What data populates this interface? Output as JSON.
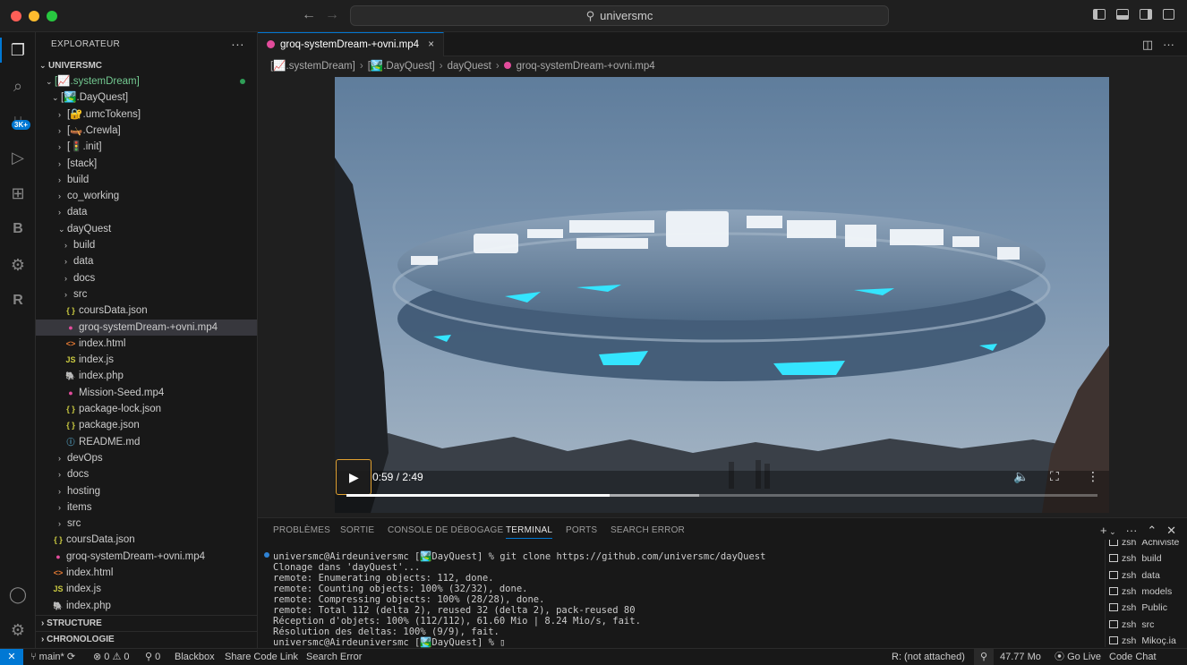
{
  "window": {
    "search_text": "universmc"
  },
  "explorer": {
    "title": "EXPLORATEUR",
    "root": "UNIVERSMC",
    "rows": [
      {
        "label": "[📈.systemDream]",
        "indent": 1,
        "type": "open",
        "green": true
      },
      {
        "label": "[🏞️.DayQuest]",
        "indent": 2,
        "type": "open"
      },
      {
        "label": "[🔐.umcTokens]",
        "indent": 3,
        "type": "closed"
      },
      {
        "label": "[🛶.Crewla]",
        "indent": 3,
        "type": "closed"
      },
      {
        "label": "[🚦.init]",
        "indent": 3,
        "type": "closed"
      },
      {
        "label": "[stack]",
        "indent": 3,
        "type": "closed"
      },
      {
        "label": "build",
        "indent": 3,
        "type": "closed"
      },
      {
        "label": "co_working",
        "indent": 3,
        "type": "closed"
      },
      {
        "label": "data",
        "indent": 3,
        "type": "closed"
      },
      {
        "label": "dayQuest",
        "indent": 3,
        "type": "open"
      },
      {
        "label": "build",
        "indent": 4,
        "type": "closed"
      },
      {
        "label": "data",
        "indent": 4,
        "type": "closed"
      },
      {
        "label": "docs",
        "indent": 4,
        "type": "closed"
      },
      {
        "label": "src",
        "indent": 4,
        "type": "closed"
      },
      {
        "label": "coursData.json",
        "indent": 4,
        "type": "json"
      },
      {
        "label": "groq-systemDream-+ovni.mp4",
        "indent": 4,
        "type": "mp4",
        "selected": true
      },
      {
        "label": "index.html",
        "indent": 4,
        "type": "html"
      },
      {
        "label": "index.js",
        "indent": 4,
        "type": "js"
      },
      {
        "label": "index.php",
        "indent": 4,
        "type": "php"
      },
      {
        "label": "Mission-Seed.mp4",
        "indent": 4,
        "type": "mp4"
      },
      {
        "label": "package-lock.json",
        "indent": 4,
        "type": "json"
      },
      {
        "label": "package.json",
        "indent": 4,
        "type": "json"
      },
      {
        "label": "README.md",
        "indent": 4,
        "type": "md"
      },
      {
        "label": "devOps",
        "indent": 3,
        "type": "closed"
      },
      {
        "label": "docs",
        "indent": 3,
        "type": "closed"
      },
      {
        "label": "hosting",
        "indent": 3,
        "type": "closed"
      },
      {
        "label": "items",
        "indent": 3,
        "type": "closed"
      },
      {
        "label": "src",
        "indent": 3,
        "type": "closed"
      },
      {
        "label": "coursData.json",
        "indent": 2,
        "type": "json"
      },
      {
        "label": "groq-systemDream-+ovni.mp4",
        "indent": 2,
        "type": "mp4"
      },
      {
        "label": "index.html",
        "indent": 2,
        "type": "html"
      },
      {
        "label": "index.js",
        "indent": 2,
        "type": "js"
      },
      {
        "label": "index.php",
        "indent": 2,
        "type": "php"
      }
    ],
    "structure_label": "STRUCTURE",
    "timeline_label": "CHRONOLOGIE"
  },
  "activity": {
    "badge": "3K+"
  },
  "editor": {
    "tab_label": "groq-systemDream-+ovni.mp4",
    "breadcrumb": [
      "[📈.systemDream]",
      "[🏞️.DayQuest]",
      "dayQuest",
      "groq-systemDream-+ovni.mp4"
    ],
    "video": {
      "time": "0:59 / 2:49",
      "progress_fraction": 0.35,
      "buffered_fraction": 0.47
    }
  },
  "panel": {
    "tabs": [
      "PROBLÈMES",
      "SORTIE",
      "CONSOLE DE DÉBOGAGE",
      "TERMINAL",
      "PORTS",
      "SEARCH ERROR"
    ],
    "terminal_lines": [
      "universmc@Airdeuniversmc [🏞️DayQuest] % git clone https://github.com/universmc/dayQuest",
      "Clonage dans 'dayQuest'...",
      "remote: Enumerating objects: 112, done.",
      "remote: Counting objects: 100% (32/32), done.",
      "remote: Compressing objects: 100% (28/28), done.",
      "remote: Total 112 (delta 2), reused 32 (delta 2), pack-reused 80",
      "Réception d'objets: 100% (112/112), 61.60 Mio | 8.24 Mio/s, fait.",
      "Résolution des deltas: 100% (9/9), fait.",
      "universmc@Airdeuniversmc [🏞️DayQuest] % ▯"
    ],
    "terminals": [
      {
        "shell": "zsh",
        "name": "Achiviste"
      },
      {
        "shell": "zsh",
        "name": "build"
      },
      {
        "shell": "zsh",
        "name": "data"
      },
      {
        "shell": "zsh",
        "name": "models"
      },
      {
        "shell": "zsh",
        "name": "Public"
      },
      {
        "shell": "zsh",
        "name": "src"
      },
      {
        "shell": "zsh",
        "name": "Mikoç.ia"
      }
    ]
  },
  "status": {
    "branch": "main*",
    "errors": "0",
    "warnings": "0",
    "ports": "0",
    "blackbox": "Blackbox",
    "share": "Share Code Link",
    "search_error": "Search Error",
    "r_status": "R: (not attached)",
    "memory": "47.77 Mo",
    "go_live": "Go Live",
    "code_chat": "Code Chat"
  }
}
